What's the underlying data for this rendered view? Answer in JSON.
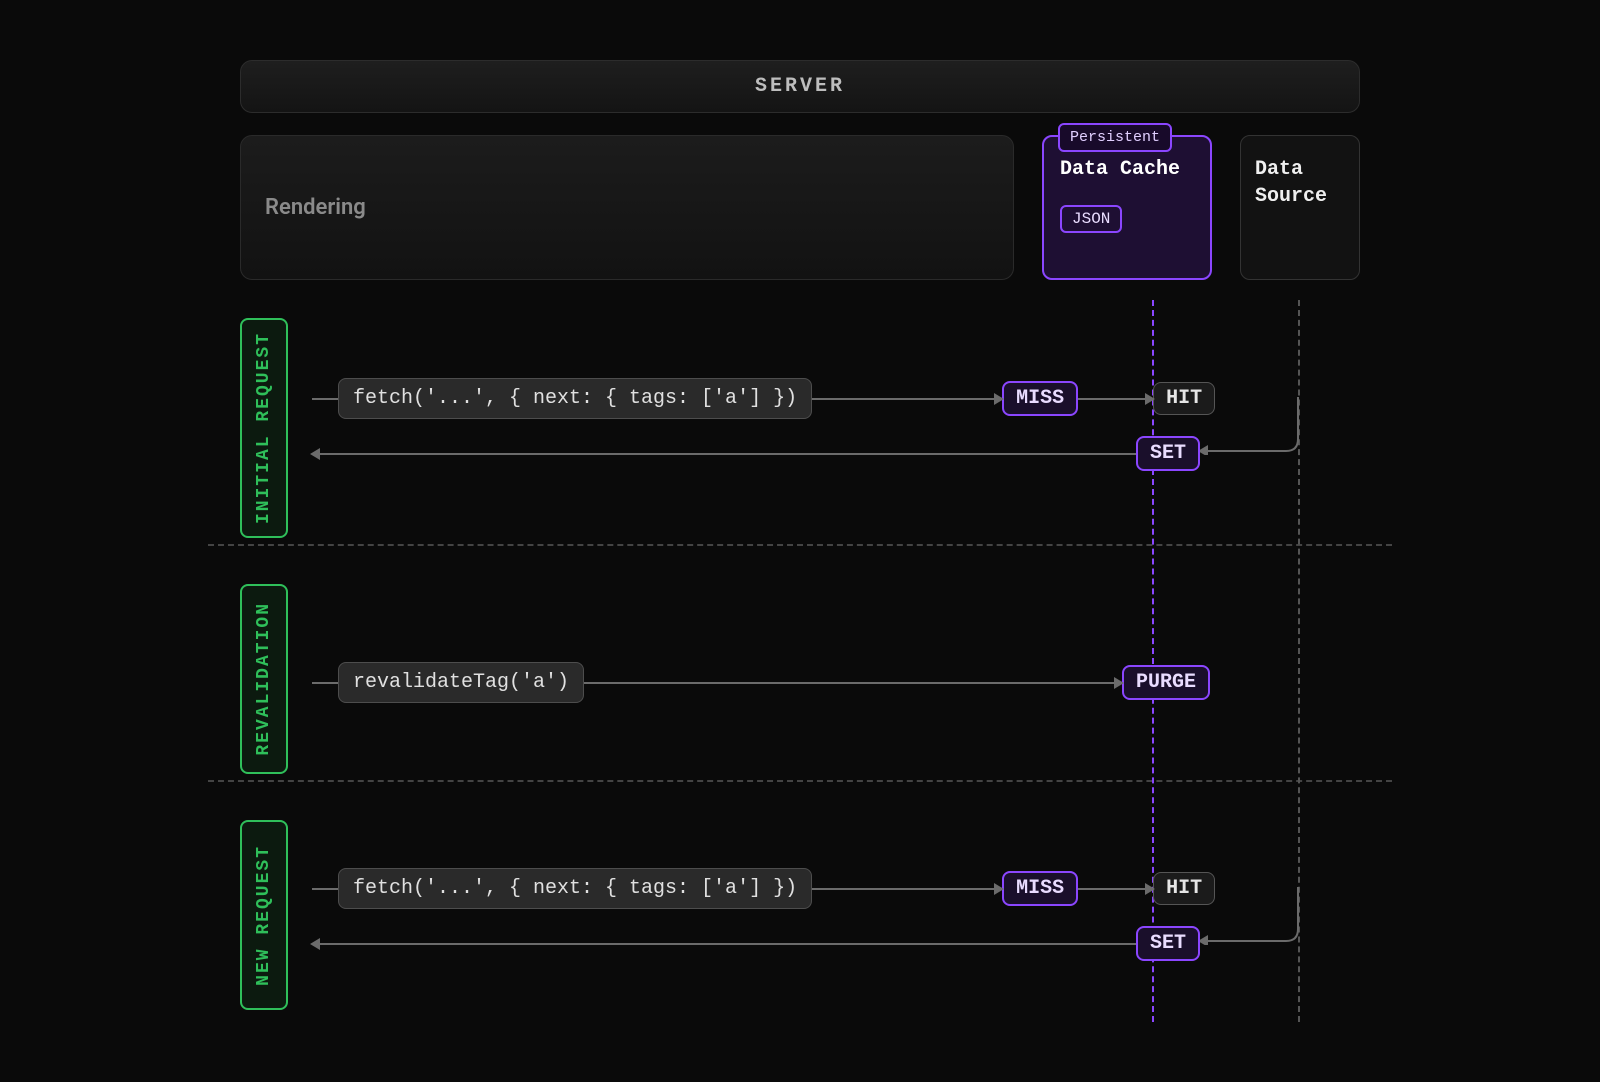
{
  "header": {
    "title": "SERVER"
  },
  "top": {
    "rendering_label": "Rendering",
    "cache": {
      "persistent_label": "Persistent",
      "title": "Data Cache",
      "json_chip": "JSON"
    },
    "source_title": "Data\nSource"
  },
  "sections": [
    {
      "label": "INITIAL REQUEST",
      "code": "fetch('...', { next: { tags: ['a'] })",
      "cache_status": "MISS",
      "source_status": "HIT",
      "set_label": "SET"
    },
    {
      "label": "REVALIDATION",
      "code": "revalidateTag('a')",
      "cache_status": "PURGE"
    },
    {
      "label": "NEW REQUEST",
      "code": "fetch('...', { next: { tags: ['a'] })",
      "cache_status": "MISS",
      "source_status": "HIT",
      "set_label": "SET"
    }
  ]
}
